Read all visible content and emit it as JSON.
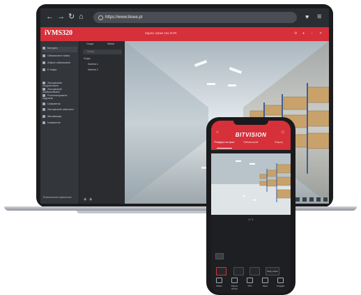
{
  "browser": {
    "url": "https://www.bisee.pl"
  },
  "desktop_app": {
    "brand": "iVMS320",
    "window_title": "Zapisz ustaw 16x DVR",
    "sidebar": {
      "items": [
        {
          "label": "Na żywo",
          "icon": "live-icon"
        },
        {
          "label": "Odtwarzanie wideo",
          "icon": "playback-icon"
        },
        {
          "label": "Zdalne odtwarzanie",
          "icon": "remote-playback-icon"
        },
        {
          "label": "E-mapa",
          "icon": "emap-icon"
        },
        {
          "label": "Zarządzanie urządzeniami",
          "icon": "device-icon"
        },
        {
          "label": "Zarządzanie użytkownikami",
          "icon": "user-icon"
        },
        {
          "label": "Przechowywanie nagrania",
          "icon": "storage-icon"
        },
        {
          "label": "Ustawienia",
          "icon": "settings-icon"
        },
        {
          "label": "Zarządzanie alarmami",
          "icon": "alarm-icon"
        },
        {
          "label": "Aktualizacja",
          "icon": "update-icon"
        },
        {
          "label": "Ustawienia",
          "icon": "config-icon"
        }
      ],
      "footer": "Rozszerzenie systemowe"
    },
    "tree": {
      "tabs": [
        "Grupa",
        "Widok"
      ],
      "search_placeholder": "Szukaj",
      "nodes": [
        "Grupa",
        "Kamera 1",
        "Kamera 2"
      ]
    }
  },
  "mobile_app": {
    "brand": "BITVISION",
    "tabs": [
      "Podgląd na żywo",
      "Odtwarzanie",
      "Więcej"
    ],
    "page_indicator": "1 / 1",
    "toolbar": [
      "",
      "",
      "",
      "Pełny ekran"
    ],
    "nav": [
      "Wideo",
      "Zdjęcie ekranu",
      "PTZ",
      "Zapis",
      "Podgląd"
    ]
  }
}
